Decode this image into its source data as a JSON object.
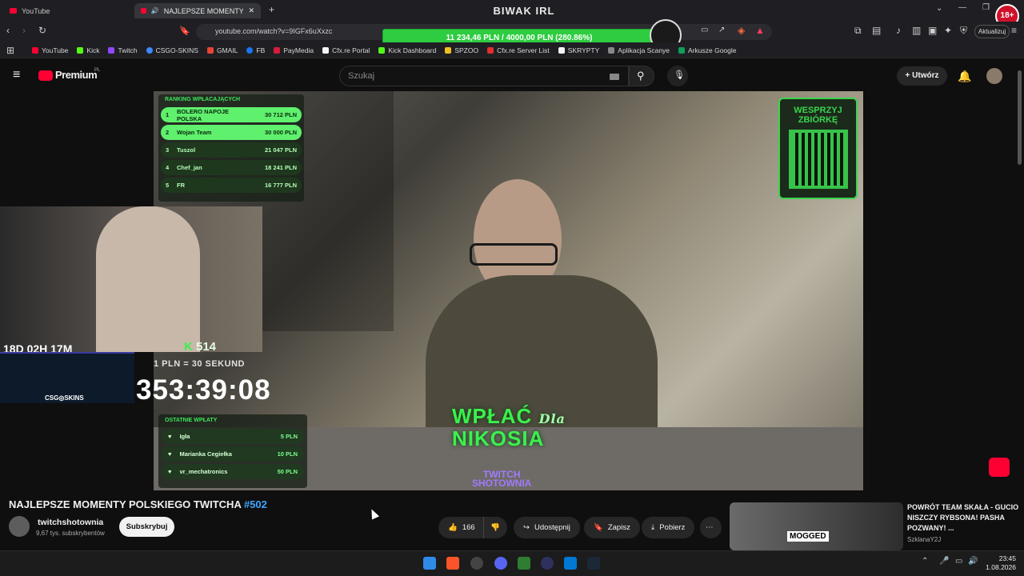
{
  "browser": {
    "tabs": [
      {
        "label": "YouTube"
      },
      {
        "label": "NAJLEPSZE MOMENTY POLSK"
      }
    ],
    "window_title": "BIWAK IRL",
    "url": "youtube.com/watch?v=9IGFx6uXxzc",
    "update_label": "Aktualizuj",
    "bookmarks": [
      "YouTube",
      "Kick",
      "Twitch",
      "CSGO-SKINS",
      "GMAIL",
      "FB",
      "PayMedia",
      "Cfx.re Portal",
      "Kick Dashboard",
      "SPZOO",
      "Cfx.re Server List",
      "SKRYPTY",
      "Aplikacja Scanye",
      "Arkusze Google"
    ],
    "age_badge": "18+"
  },
  "donation_goal": {
    "text": "11 234,46 PLN / 4000,00 PLN (280.86%)"
  },
  "youtube": {
    "logo": "Premium",
    "logo_region": "PL",
    "search_placeholder": "Szukaj",
    "create_label": "Utwórz"
  },
  "overlay": {
    "ranking_title": "RANKING WPŁACAJĄCYCH",
    "ranking": [
      {
        "n": "1",
        "name": "BOLERO NAPOJE POLSKA",
        "amount": "30 712 PLN"
      },
      {
        "n": "2",
        "name": "Wojan Team",
        "amount": "30 000 PLN"
      },
      {
        "n": "3",
        "name": "Tuszol",
        "amount": "21 047 PLN"
      },
      {
        "n": "4",
        "name": "Chef_jan",
        "amount": "18 241 PLN"
      },
      {
        "n": "5",
        "name": "FR",
        "amount": "16 777 PLN"
      }
    ],
    "qr_label_1": "WESPRZYJ",
    "qr_label_2": "ZBIÓRKĘ",
    "timer_small": "18D 02H 17M",
    "kick_count": "514",
    "rate": "1 PLN = 30 SEKUND",
    "countdown": "353:39:08",
    "csgo_label": "CSG◎SKINS",
    "recent_title": "OSTATNIE WPŁATY",
    "recent": [
      {
        "name": "Igła",
        "amount": "5 PLN"
      },
      {
        "name": "Marianka Cegiełka",
        "amount": "10 PLN"
      },
      {
        "name": "vr_mechatronics",
        "amount": "50 PLN"
      }
    ],
    "promo_line1": "WPŁAĆ",
    "promo_script": "Dla",
    "promo_line2": "NIKOSIA",
    "brand_line1": "TWITCH",
    "brand_line2": "SHOTOWNIA"
  },
  "video": {
    "title": "NAJLEPSZE MOMENTY POLSKIEGO TWITCHA ",
    "title_tag": "#502",
    "channel": "twitchshotownia",
    "subscribers": "9,67 tys. subskrybentów",
    "subscribe_label": "Subskrybuj",
    "likes": "166",
    "share_label": "Udostępnij",
    "save_label": "Zapisz",
    "download_label": "Pobierz"
  },
  "recommendation": {
    "title": "POWRÓT TEAM SKAŁA - GUCIO NISZCZY RYBSONA! PASHA POZWANY! ...",
    "channel": "SzklanaY2J",
    "thumb_badge": "MOGGED"
  },
  "taskbar": {
    "time": "23:45",
    "date": "1.08.2026"
  },
  "colors": {
    "accent_green": "#2ecc40",
    "youtube_red": "#ff0033",
    "link_blue": "#3ea6ff"
  }
}
